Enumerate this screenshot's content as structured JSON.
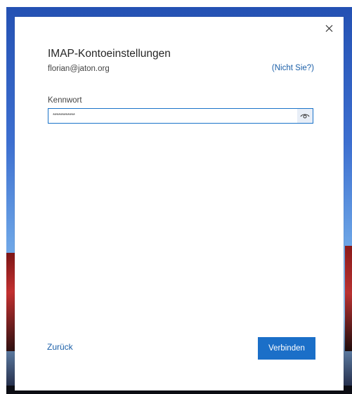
{
  "dialog": {
    "title": "IMAP-Kontoeinstellungen",
    "email": "florian@jaton.org",
    "not_you_link": "(Nicht Sie?)",
    "close_icon": "close-icon",
    "password": {
      "label": "Kennwort",
      "value": "************",
      "reveal_icon": "eye-icon"
    },
    "back_link": "Zurück",
    "connect_button": "Verbinden"
  },
  "colors": {
    "accent": "#1b6fc8",
    "link": "#1b5fa8",
    "field_border": "#1a73c9"
  }
}
